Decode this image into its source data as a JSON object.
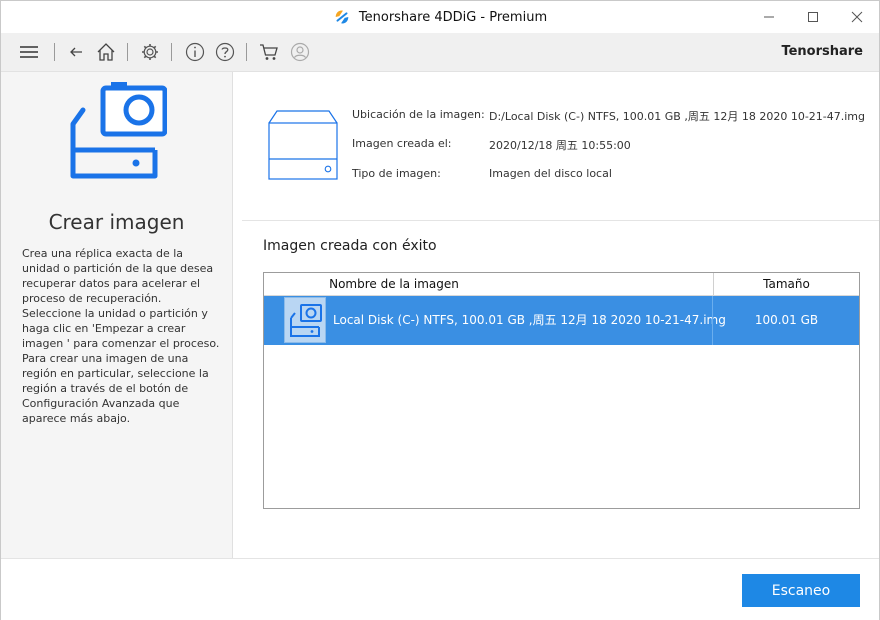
{
  "window": {
    "title": "Tenorshare 4DDiG - Premium"
  },
  "toolbar": {
    "brand": "Tenorshare",
    "icons": [
      "menu-icon",
      "back-icon",
      "home-icon",
      "settings-icon",
      "info-icon",
      "help-icon",
      "cart-icon",
      "account-icon"
    ]
  },
  "left_panel": {
    "title": "Crear imagen",
    "description": "Crea una réplica exacta de la unidad o partición de la que desea recuperar datos para acelerar el proceso de recuperación. Seleccione la unidad o partición y haga clic en  'Empezar a crear imagen ' para comenzar el proceso. Para crear una imagen de una región en particular, seleccione la región a través de el botón de Configuración Avanzada que aparece más abajo."
  },
  "image_info": {
    "location_label": "Ubicación de la imagen:",
    "location_value": "D:/Local Disk (C-) NTFS, 100.01 GB ,周五 12月 18 2020 10-21-47.img",
    "created_label": "Imagen creada el:",
    "created_value": "2020/12/18 周五 10:55:00",
    "type_label": "Tipo de imagen:",
    "type_value": "Imagen del disco local"
  },
  "result": {
    "title": "Imagen creada con éxito",
    "columns": [
      "Nombre de la imagen",
      "Tamaño"
    ],
    "rows": [
      {
        "name": "Local Disk (C-) NTFS, 100.01 GB ,周五 12月 18 2020 10-21-47.img",
        "size": "100.01 GB",
        "selected": true
      }
    ]
  },
  "footer": {
    "scan_label": "Escaneo"
  },
  "colors": {
    "accent": "#1e88e5",
    "selected_row": "#3a8fe3",
    "icon_blue": "#1a73e8"
  }
}
